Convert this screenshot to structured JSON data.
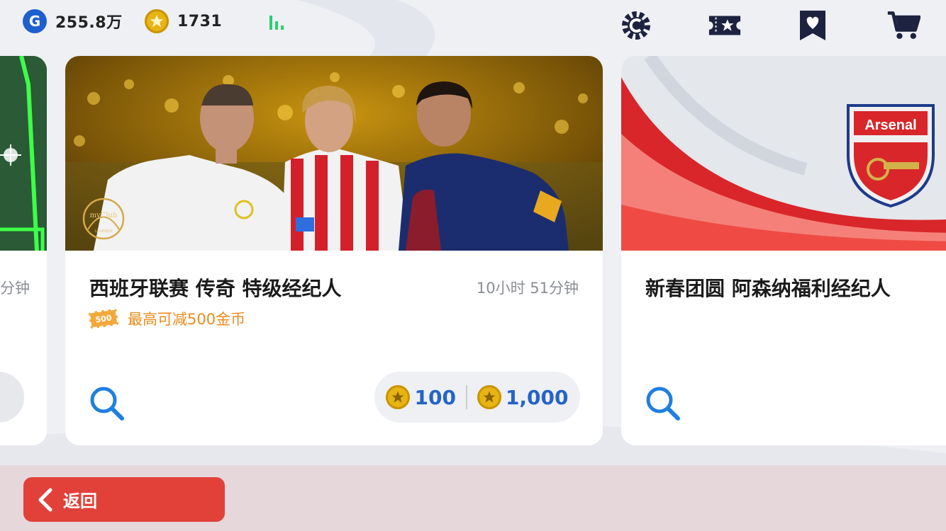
{
  "topbar": {
    "gp_icon_letter": "G",
    "gp_value": "255.8万",
    "coins_value": "1731",
    "icons": [
      "gear-icon",
      "ticket-icon",
      "heart-bookmark-icon",
      "cart-icon"
    ]
  },
  "cards": {
    "left": {
      "timer": "分钟"
    },
    "main": {
      "banner_badge": "myClub LEGENDS",
      "title": "西班牙联赛 传奇 特级经纪人",
      "timer": "10小时 51分钟",
      "ticket_value": "500",
      "discount": "最高可减500金币",
      "price_1": "100",
      "price_2": "1,000"
    },
    "right": {
      "club_badge": "Arsenal",
      "title": "新春团圆 阿森纳福利经纪人"
    }
  },
  "bottom": {
    "back_label": "返回"
  },
  "colors": {
    "accent_blue": "#2563c9",
    "coin_gold": "#e7b414",
    "back_red": "#e2413a",
    "discount_orange": "#ee8a1c"
  }
}
